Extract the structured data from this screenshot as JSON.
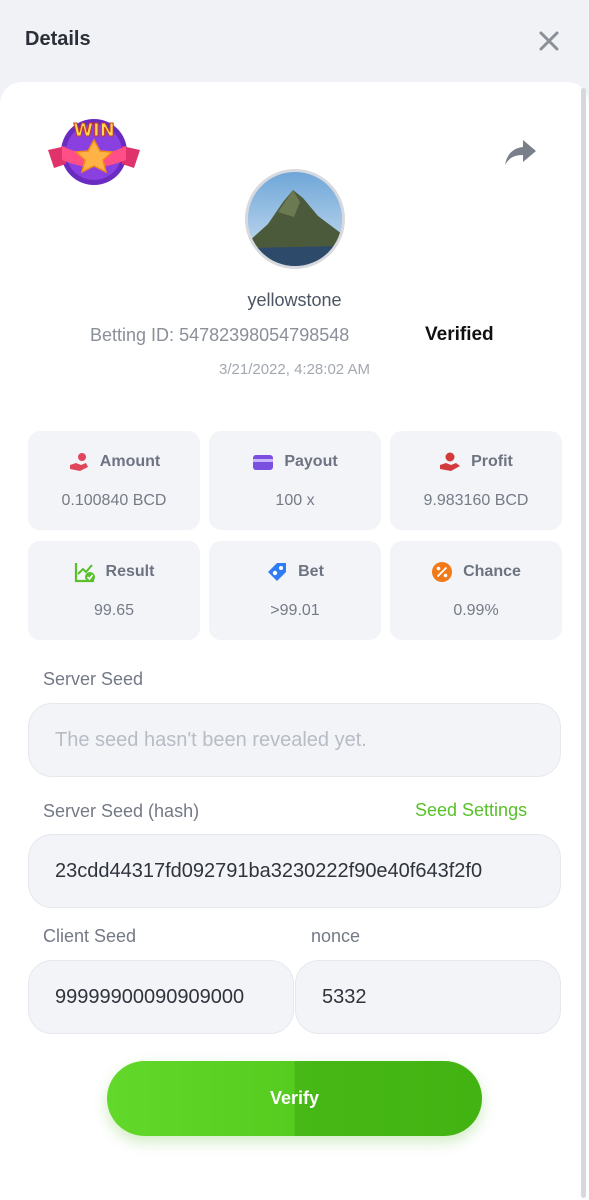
{
  "header": {
    "title": "Details"
  },
  "bet": {
    "username": "yellowstone",
    "betting_id_label": "Betting ID:",
    "betting_id": "54782398054798548",
    "verified_label": "Verified",
    "timestamp": "3/21/2022, 4:28:02 AM",
    "logo_text": "WIN"
  },
  "stats": [
    {
      "label": "Amount",
      "value": "0.100840 BCD",
      "icon": "hand-coin-icon"
    },
    {
      "label": "Payout",
      "value": "100 x",
      "icon": "card-icon"
    },
    {
      "label": "Profit",
      "value": "9.983160 BCD",
      "icon": "profit-icon"
    },
    {
      "label": "Result",
      "value": "99.65",
      "icon": "chart-check-icon"
    },
    {
      "label": "Bet",
      "value": ">99.01",
      "icon": "tag-icon"
    },
    {
      "label": "Chance",
      "value": "0.99%",
      "icon": "percent-icon"
    }
  ],
  "server_seed": {
    "label": "Server Seed",
    "placeholder": "The seed hasn't been revealed yet."
  },
  "server_seed_hash": {
    "label": "Server Seed (hash)",
    "settings_link": "Seed Settings",
    "value": "23cdd44317fd092791ba3230222f90e40f643f2f0"
  },
  "client_seed": {
    "label": "Client Seed",
    "value": "99999900090909000"
  },
  "nonce": {
    "label": "nonce",
    "value": "5332"
  },
  "verify_button": {
    "label": "Verify"
  },
  "colors": {
    "accent_green": "#58c02a",
    "amount_red": "#e0475a",
    "payout_purple": "#7b4fe0",
    "profit_red": "#d23b3b",
    "result_green": "#58c02a",
    "bet_blue": "#2f7cf6",
    "chance_orange": "#f07a1a"
  }
}
